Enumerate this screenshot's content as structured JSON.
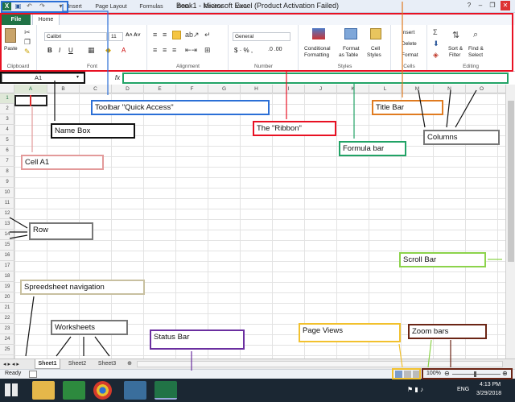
{
  "window": {
    "title": "Book1  -  Microsoft Excel (Product Activation Failed)",
    "controls": [
      "?",
      "–",
      "❐",
      "✕"
    ]
  },
  "tabs": [
    "File",
    "Home",
    "Insert",
    "Page Layout",
    "Formulas",
    "Data",
    "Review",
    "View"
  ],
  "ribbon": {
    "clipboard": {
      "paste": "Paste",
      "label": "Clipboard"
    },
    "font": {
      "name": "Calibri",
      "size": "11",
      "label": "Font"
    },
    "alignment": {
      "label": "Alignment"
    },
    "number": {
      "format": "General",
      "label": "Number"
    },
    "styles": {
      "cond": "Conditional",
      "cond2": "Formatting",
      "fmt": "Format",
      "fmt2": "as Table",
      "cell": "Cell",
      "cell2": "Styles",
      "label": "Styles"
    },
    "cells": {
      "insert": "Insert",
      "delete": "Delete",
      "format": "Format",
      "label": "Cells"
    },
    "editing": {
      "sort": "Sort &",
      "sort2": "Filter",
      "find": "Find &",
      "find2": "Select",
      "label": "Editing"
    }
  },
  "formula": {
    "namebox": "A1",
    "fx": "fx"
  },
  "columns": [
    "A",
    "B",
    "C",
    "D",
    "E",
    "F",
    "G",
    "H",
    "I",
    "J",
    "K",
    "L",
    "M",
    "N",
    "O"
  ],
  "rows": [
    "1",
    "2",
    "3",
    "4",
    "5",
    "6",
    "7",
    "8",
    "9",
    "10",
    "11",
    "12",
    "13",
    "14",
    "15",
    "16",
    "17",
    "18",
    "19",
    "20",
    "21",
    "22",
    "23",
    "24",
    "25"
  ],
  "sheets": [
    "Sheet1",
    "Sheet2",
    "Sheet3"
  ],
  "status": {
    "ready": "Ready",
    "zoom": "100%"
  },
  "clock": {
    "time": "4:13 PM",
    "date": "3/29/2018",
    "lang": "ENG"
  },
  "annotations": {
    "toolbar": "Toolbar \"Quick Access\"",
    "namebox": "Name Box",
    "ribbon": "The \"Ribbon\"",
    "title": "Title Bar",
    "columns": "Columns",
    "formula": "Formula bar",
    "cell": "Cell A1",
    "row": "Row",
    "scroll": "Scroll Bar",
    "nav": "Spreedsheet navigation",
    "worksheets": "Worksheets",
    "statusbar": "Status Bar",
    "pageviews": "Page Views",
    "zoombars": "Zoom bars"
  },
  "colors": {
    "excel_green": "#217346",
    "ribbon_box": "#e81123",
    "formula_box": "#21a366",
    "title_box": "#e07b20",
    "scroll_box": "#8cd34b",
    "status_box": "#6b2fa0",
    "zoom_box": "#6b2515",
    "pageviews_box": "#f2c12e"
  }
}
